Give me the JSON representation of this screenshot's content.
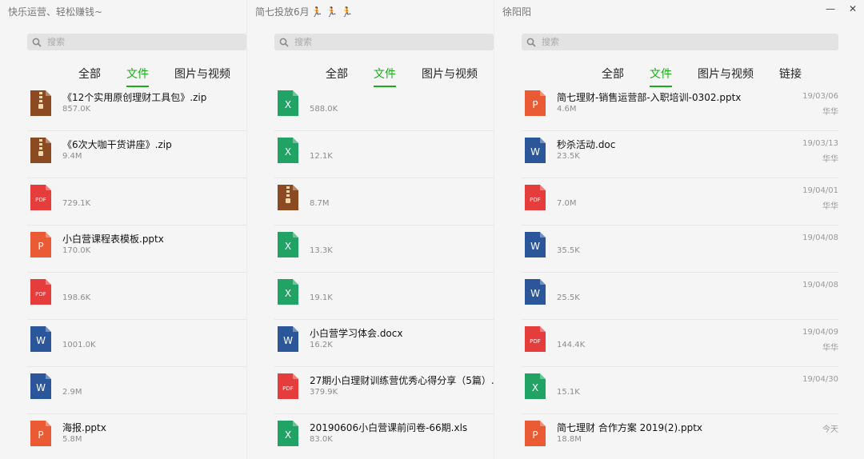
{
  "colors": {
    "accent": "#1aad19",
    "zip": "#8b4a22",
    "pdf": "#e53c3c",
    "ppt": "#ea5a35",
    "word": "#2b579a",
    "excel": "#21a366"
  },
  "window_controls": {
    "minimize": "—",
    "close": "✕"
  },
  "panels": [
    {
      "title": "快乐运营、轻松赚钱~",
      "runner_icons": "",
      "search": {
        "placeholder": "搜索"
      },
      "tabs": [
        {
          "label": "全部",
          "active": false
        },
        {
          "label": "文件",
          "active": true
        },
        {
          "label": "图片与视频",
          "active": false
        }
      ],
      "files": [
        {
          "type": "zip",
          "name": "《12个实用原创理财工具包》.zip",
          "size": "857.0K",
          "date": "",
          "sender": ""
        },
        {
          "type": "zip",
          "name": "《6次大咖干货讲座》.zip",
          "size": "9.4M",
          "date": "",
          "sender": ""
        },
        {
          "type": "pdf",
          "name": "",
          "size": "729.1K",
          "date": "",
          "sender": ""
        },
        {
          "type": "ppt",
          "name": "小白营课程表模板.pptx",
          "size": "170.0K",
          "date": "",
          "sender": ""
        },
        {
          "type": "pdf",
          "name": "",
          "size": "198.6K",
          "date": "",
          "sender": ""
        },
        {
          "type": "word",
          "name": "",
          "size": "1001.0K",
          "date": "",
          "sender": ""
        },
        {
          "type": "word",
          "name": "",
          "size": "2.9M",
          "date": "",
          "sender": ""
        },
        {
          "type": "ppt",
          "name": "海报.pptx",
          "size": "5.8M",
          "date": "",
          "sender": ""
        }
      ]
    },
    {
      "title": "简七投放6月",
      "runner_icons": "🏃 🏃 🏃",
      "search": {
        "placeholder": "搜索"
      },
      "tabs": [
        {
          "label": "全部",
          "active": false
        },
        {
          "label": "文件",
          "active": true
        },
        {
          "label": "图片与视频",
          "active": false
        }
      ],
      "files": [
        {
          "type": "excel",
          "name": "",
          "size": "588.0K",
          "date": "",
          "sender": ""
        },
        {
          "type": "excel",
          "name": "",
          "size": "12.1K",
          "date": "",
          "sender": ""
        },
        {
          "type": "zip",
          "name": "",
          "size": "8.7M",
          "date": "",
          "sender": ""
        },
        {
          "type": "excel",
          "name": "",
          "size": "13.3K",
          "date": "",
          "sender": ""
        },
        {
          "type": "excel",
          "name": "",
          "size": "19.1K",
          "date": "",
          "sender": ""
        },
        {
          "type": "word",
          "name": "小白营学习体会.docx",
          "size": "16.2K",
          "date": "",
          "sender": ""
        },
        {
          "type": "pdf",
          "name": "27期小白理财训练营优秀心得分享（5篇）.p",
          "size": "379.9K",
          "date": "",
          "sender": ""
        },
        {
          "type": "excel",
          "name": "20190606小白营课前问卷-66期.xls",
          "size": "83.0K",
          "date": "",
          "sender": ""
        }
      ]
    },
    {
      "title": "徐阳阳",
      "runner_icons": "",
      "search": {
        "placeholder": "搜索"
      },
      "tabs": [
        {
          "label": "全部",
          "active": false
        },
        {
          "label": "文件",
          "active": true
        },
        {
          "label": "图片与视频",
          "active": false
        },
        {
          "label": "链接",
          "active": false
        }
      ],
      "files": [
        {
          "type": "ppt",
          "name": "简七理财-销售运营部-入职培训-0302.pptx",
          "size": "4.6M",
          "date": "19/03/06",
          "sender": "华华"
        },
        {
          "type": "word",
          "name": "秒杀活动.doc",
          "size": "23.5K",
          "date": "19/03/13",
          "sender": "华华"
        },
        {
          "type": "pdf",
          "name": "",
          "size": "7.0M",
          "date": "19/04/01",
          "sender": "华华"
        },
        {
          "type": "word",
          "name": "",
          "size": "35.5K",
          "date": "19/04/08",
          "sender": ""
        },
        {
          "type": "word",
          "name": "",
          "size": "25.5K",
          "date": "19/04/08",
          "sender": ""
        },
        {
          "type": "pdf",
          "name": "",
          "size": "144.4K",
          "date": "19/04/09",
          "sender": "华华"
        },
        {
          "type": "excel",
          "name": "",
          "size": "15.1K",
          "date": "19/04/30",
          "sender": ""
        },
        {
          "type": "ppt",
          "name": "简七理财 合作方案 2019(2).pptx",
          "size": "18.8M",
          "date": "今天",
          "sender": ""
        }
      ]
    }
  ]
}
